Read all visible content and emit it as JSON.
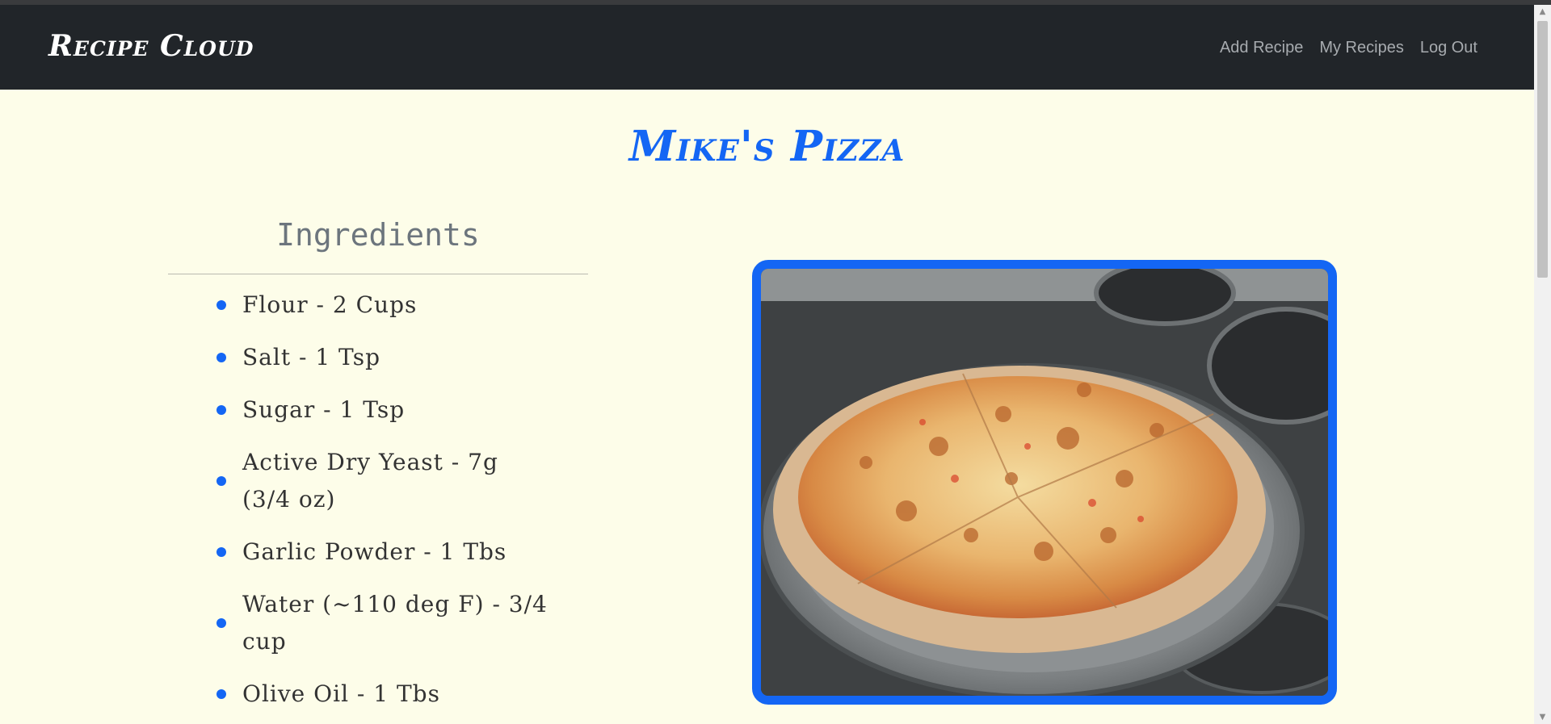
{
  "navbar": {
    "brand": "Recipe Cloud",
    "links": [
      "Add Recipe",
      "My Recipes",
      "Log Out"
    ]
  },
  "recipe": {
    "title": "Mike's Pizza",
    "ingredients_heading": "Ingredients",
    "ingredients": [
      "Flour - 2 Cups",
      "Salt - 1 Tsp",
      "Sugar - 1 Tsp",
      "Active Dry Yeast - 7g (3/4 oz)",
      "Garlic Powder - 1 Tbs",
      "Water (~110 deg F) - 3/4 cup",
      "Olive Oil - 1 Tbs"
    ],
    "photo_subject": "cheese pizza on pan"
  },
  "colors": {
    "accent": "#1466f4",
    "navbar": "#212529",
    "background": "#fdfde9"
  }
}
